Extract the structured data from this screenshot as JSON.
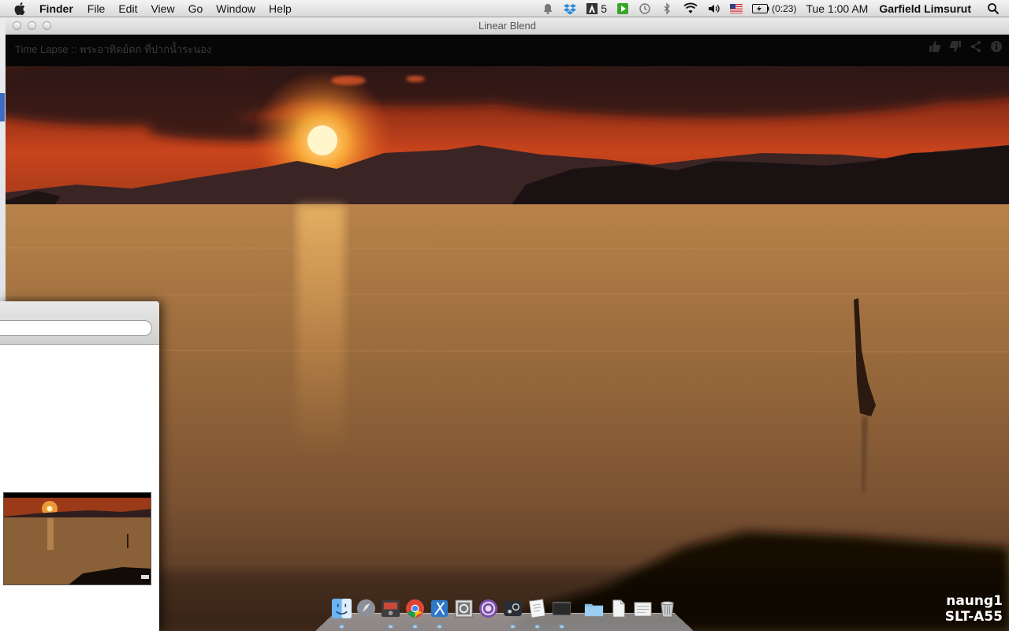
{
  "menubar": {
    "app_name": "Finder",
    "menus": [
      "File",
      "Edit",
      "View",
      "Go",
      "Window",
      "Help"
    ],
    "status": {
      "adobe_count": "5",
      "battery": "(0:23)",
      "clock": "Tue 1:00 AM",
      "user": "Garfield Limsurut"
    }
  },
  "window": {
    "title": "Linear Blend",
    "video_title": "Time Lapse :: พระอาทิตย์ตก ที่ปากน้ำระนอง",
    "watermark_line1": "naung1",
    "watermark_line2": "SLT-A55"
  },
  "finder": {
    "search_placeholder": ""
  },
  "dock": {
    "items": [
      {
        "name": "Finder",
        "icon": "finder-icon",
        "running": true
      },
      {
        "name": "Launchpad",
        "icon": "launchpad-icon",
        "running": false
      },
      {
        "name": "Photo Booth",
        "icon": "photo-booth-icon",
        "running": true
      },
      {
        "name": "Google Chrome",
        "icon": "chrome-icon",
        "running": true
      },
      {
        "name": "Xcode",
        "icon": "xcode-icon",
        "running": true
      },
      {
        "name": "Preview",
        "icon": "preview-icon",
        "running": false
      },
      {
        "name": "Tor Browser",
        "icon": "tor-icon",
        "running": false
      },
      {
        "name": "Steam",
        "icon": "steam-icon",
        "running": true
      },
      {
        "name": "TextEdit",
        "icon": "textedit-icon",
        "running": true
      },
      {
        "name": "Terminal",
        "icon": "terminal-icon",
        "running": true
      },
      {
        "name": "Applications",
        "icon": "folder-icon",
        "running": false
      },
      {
        "name": "Documents",
        "icon": "document-icon",
        "running": false
      },
      {
        "name": "Downloads",
        "icon": "downloads-stack-icon",
        "running": false
      },
      {
        "name": "Trash",
        "icon": "trash-icon",
        "running": false
      }
    ]
  },
  "colors": {
    "sky_orange": "#d2461c",
    "sun": "#fff4c8",
    "water": "#9a6a3a"
  }
}
